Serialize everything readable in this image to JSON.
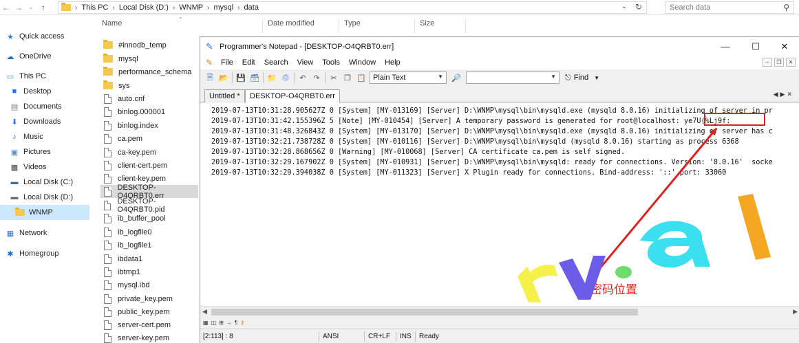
{
  "explorer": {
    "breadcrumb": [
      "This PC",
      "Local Disk (D:)",
      "WNMP",
      "mysql",
      "data"
    ],
    "search_placeholder": "Search data",
    "columns": {
      "name": "Name",
      "date_modified": "Date modified",
      "type": "Type",
      "size": "Size"
    },
    "nav_items": [
      {
        "label": "Quick access",
        "icon": "star-icon"
      },
      {
        "label": "OneDrive",
        "icon": "cloud-icon"
      },
      {
        "label": "This PC",
        "icon": "computer-icon"
      },
      {
        "label": "Desktop",
        "icon": "desktop-icon"
      },
      {
        "label": "Documents",
        "icon": "documents-icon"
      },
      {
        "label": "Downloads",
        "icon": "download-icon"
      },
      {
        "label": "Music",
        "icon": "music-icon"
      },
      {
        "label": "Pictures",
        "icon": "pictures-icon"
      },
      {
        "label": "Videos",
        "icon": "videos-icon"
      },
      {
        "label": "Local Disk (C:)",
        "icon": "drive-icon"
      },
      {
        "label": "Local Disk (D:)",
        "icon": "drive-icon"
      },
      {
        "label": "WNMP",
        "icon": "folder-icon"
      },
      {
        "label": "Network",
        "icon": "network-icon"
      },
      {
        "label": "Homegroup",
        "icon": "homegroup-icon"
      }
    ],
    "files": [
      {
        "name": "#innodb_temp",
        "kind": "folder"
      },
      {
        "name": "mysql",
        "kind": "folder"
      },
      {
        "name": "performance_schema",
        "kind": "folder"
      },
      {
        "name": "sys",
        "kind": "folder"
      },
      {
        "name": "auto.cnf",
        "kind": "file"
      },
      {
        "name": "binlog.000001",
        "kind": "file"
      },
      {
        "name": "binlog.index",
        "kind": "file"
      },
      {
        "name": "ca.pem",
        "kind": "file"
      },
      {
        "name": "ca-key.pem",
        "kind": "file"
      },
      {
        "name": "client-cert.pem",
        "kind": "file"
      },
      {
        "name": "client-key.pem",
        "kind": "file"
      },
      {
        "name": "DESKTOP-O4QRBT0.err",
        "kind": "file"
      },
      {
        "name": "DESKTOP-O4QRBT0.pid",
        "kind": "file"
      },
      {
        "name": "ib_buffer_pool",
        "kind": "file"
      },
      {
        "name": "ib_logfile0",
        "kind": "file"
      },
      {
        "name": "ib_logfile1",
        "kind": "file"
      },
      {
        "name": "ibdata1",
        "kind": "file"
      },
      {
        "name": "ibtmp1",
        "kind": "file"
      },
      {
        "name": "mysql.ibd",
        "kind": "file"
      },
      {
        "name": "private_key.pem",
        "kind": "file"
      },
      {
        "name": "public_key.pem",
        "kind": "file"
      },
      {
        "name": "server-cert.pem",
        "kind": "file"
      },
      {
        "name": "server-key.pem",
        "kind": "file"
      }
    ]
  },
  "notepad": {
    "title": "Programmer's Notepad - [DESKTOP-O4QRBT0.err]",
    "menu": [
      "File",
      "Edit",
      "Search",
      "View",
      "Tools",
      "Window",
      "Help"
    ],
    "scheme": "Plain Text",
    "find_label": "Find",
    "tabs": [
      "Untitled *",
      "DESKTOP-O4QRBT0.err"
    ],
    "lines": [
      "2019-07-13T10:31:28.905627Z 0 [System] [MY-013169] [Server] D:\\WNMP\\mysql\\bin\\mysqld.exe (mysqld 8.0.16) initializing of server in pr",
      "2019-07-13T10:31:42.155396Z 5 [Note] [MY-010454] [Server] A temporary password is generated for root@localhost: ye7U(%Lj9f:",
      "2019-07-13T10:31:48.326843Z 0 [System] [MY-013170] [Server] D:\\WNMP\\mysql\\bin\\mysqld.exe (mysqld 8.0.16) initializing of server has c",
      "2019-07-13T10:32:21.738728Z 0 [System] [MY-010116] [Server] D:\\WNMP\\mysql\\bin\\mysqld (mysqld 8.0.16) starting as process 6368",
      "2019-07-13T10:32:28.868656Z 0 [Warning] [MY-010068] [Server] CA certificate ca.pem is self signed.",
      "2019-07-13T10:32:29.167902Z 0 [System] [MY-010931] [Server] D:\\WNMP\\mysql\\bin\\mysqld: ready for connections. Version: '8.0.16'  socke",
      "2019-07-13T10:32:29.394038Z 0 [System] [MY-011323] [Server] X Plugin ready for connections. Bind-address: '::' port: 33060"
    ],
    "status": {
      "position": "[2:113] : 8",
      "encoding": "ANSI",
      "line_endings": "CR+LF",
      "mode": "INS",
      "state": "Ready"
    }
  },
  "annotation": {
    "label": "密码位置",
    "color": "#e0201e"
  },
  "watermark": {
    "text": "rv.al"
  }
}
